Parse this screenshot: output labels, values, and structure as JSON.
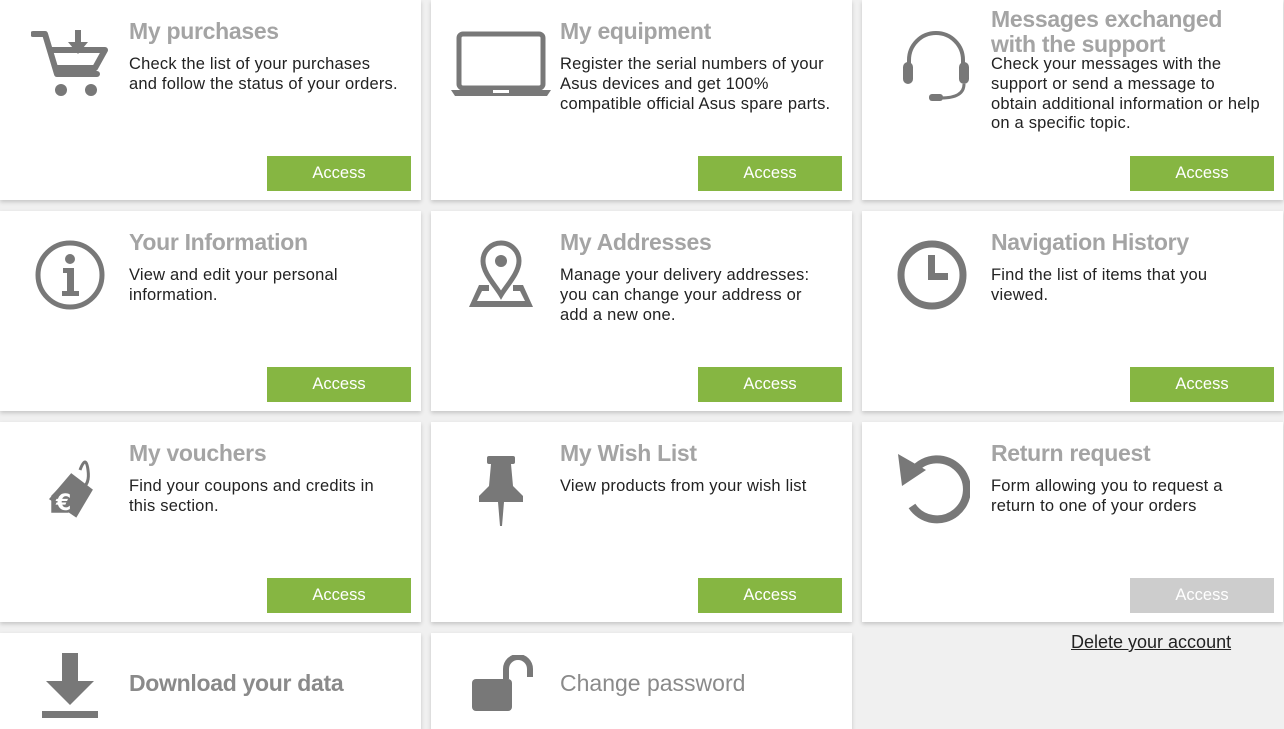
{
  "cards": [
    {
      "icon": "shopping-cart-icon",
      "title": "My purchases",
      "description": "Check the list of your purchases and follow the status of your orders.",
      "button": "Access"
    },
    {
      "icon": "laptop-icon",
      "title": "My equipment",
      "description": "Register the serial numbers of your Asus devices and get 100% compatible official Asus spare parts.",
      "button": "Access"
    },
    {
      "icon": "headset-icon",
      "title": "Messages exchanged with the support",
      "description": "Check your messages with the support or send a message to obtain additional information or help on a specific topic.",
      "button": "Access"
    },
    {
      "icon": "info-icon",
      "title": "Your Information",
      "description": "View and edit your personal information.",
      "button": "Access"
    },
    {
      "icon": "map-pin-icon",
      "title": "My Addresses",
      "description": "Manage your delivery addresses: you can change your address or add a new one.",
      "button": "Access"
    },
    {
      "icon": "clock-icon",
      "title": "Navigation History",
      "description": "Find the list of items that you viewed.",
      "button": "Access"
    },
    {
      "icon": "euro-tag-icon",
      "title": "My vouchers",
      "description": "Find your coupons and credits in this section.",
      "button": "Access"
    },
    {
      "icon": "pushpin-icon",
      "title": "My Wish List",
      "description": "View products from your wish list",
      "button": "Access"
    },
    {
      "icon": "undo-arrow-icon",
      "title": "Return request",
      "description": "Form allowing you to request a return to one of your orders",
      "button": "Access",
      "button_disabled": true
    }
  ],
  "download_data": {
    "icon": "download-icon",
    "label": "Download your data"
  },
  "change_password": {
    "icon": "unlocked-padlock-icon",
    "label": "Change password"
  },
  "delete_account": {
    "label": "Delete your account"
  },
  "colors": {
    "button_green": "#86b642",
    "button_disabled": "#cdcdcd",
    "title_gray": "#a4a4a4",
    "icon_gray": "#787878"
  }
}
